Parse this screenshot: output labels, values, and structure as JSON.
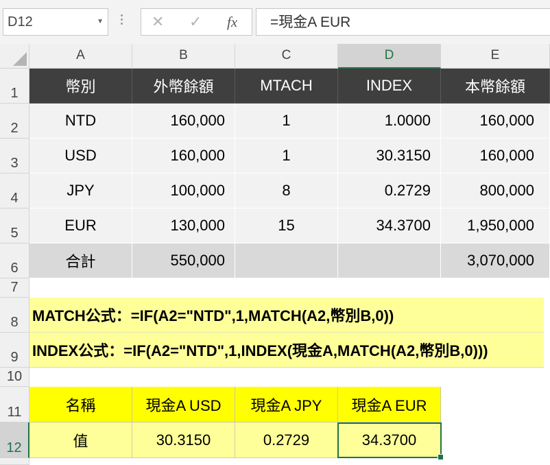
{
  "formula_bar": {
    "name_box": "D12",
    "cancel_icon": "✕",
    "enter_icon": "✓",
    "function_icon": "fx",
    "formula": "=現金A EUR"
  },
  "columns": [
    "A",
    "B",
    "C",
    "D",
    "E"
  ],
  "rows": [
    "1",
    "2",
    "3",
    "4",
    "5",
    "6",
    "7",
    "8",
    "9",
    "10",
    "11",
    "12"
  ],
  "header_row": [
    "幣別",
    "外幣餘額",
    "MTACH",
    "INDEX",
    "本幣餘額"
  ],
  "data_rows": [
    [
      "NTD",
      "160,000",
      "1",
      "1.0000",
      "160,000"
    ],
    [
      "USD",
      "160,000",
      "1",
      "30.3150",
      "160,000"
    ],
    [
      "JPY",
      "100,000",
      "8",
      "0.2729",
      "800,000"
    ],
    [
      "EUR",
      "130,000",
      "15",
      "34.3700",
      "1,950,000"
    ]
  ],
  "total_row": [
    "合計",
    "550,000",
    "",
    "",
    "3,070,000"
  ],
  "notes": {
    "match_formula": "MATCH公式：=IF(A2=\"NTD\",1,MATCH(A2,幣別B,0))",
    "index_formula": "INDEX公式：=IF(A2=\"NTD\",1,INDEX(現金A,MATCH(A2,幣別B,0)))"
  },
  "lookup_table": {
    "headers": [
      "名稱",
      "現金A USD",
      "現金A JPY",
      "現金A EUR"
    ],
    "values": [
      "值",
      "30.3150",
      "0.2729",
      "34.3700"
    ]
  },
  "selected_cell": "D12",
  "colors": {
    "header_fill": "#3f3f3f",
    "light_fill": "#f2f2f2",
    "total_fill": "#d9d9d9",
    "note_fill": "#ffff99",
    "lookup_header_fill": "#ffff00",
    "selection": "#217346"
  }
}
